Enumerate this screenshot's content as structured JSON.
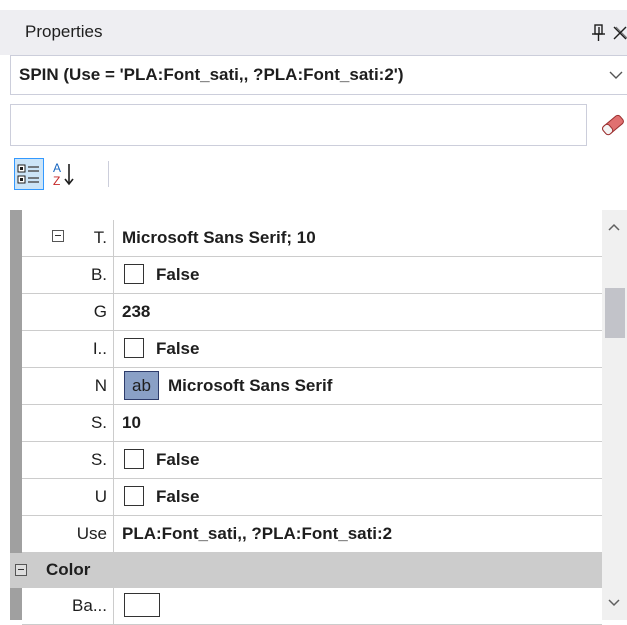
{
  "panel": {
    "title": "Properties",
    "pin_icon": "pin-icon",
    "close_icon": "close-icon"
  },
  "object_selector": {
    "value": "SPIN (Use = 'PLA:Font_sati,, ?PLA:Font_sati:2')"
  },
  "search": {
    "value": "",
    "eraser_icon": "eraser-icon"
  },
  "toolbar": {
    "categorized_icon": "categorized-view-icon",
    "alphabetical_icon": "alphabetical-sort-icon"
  },
  "grid": {
    "rows": [
      {
        "name": "T.",
        "value": "Microsoft Sans Serif; 10",
        "expanded": true
      },
      {
        "name": "B.",
        "value": "False",
        "checkbox": true
      },
      {
        "name": "G",
        "value": "238"
      },
      {
        "name": "I..",
        "value": "False",
        "checkbox": true
      },
      {
        "name": "N",
        "value": "Microsoft Sans Serif",
        "ab_prefix": "ab"
      },
      {
        "name": "S.",
        "value": "10"
      },
      {
        "name": "S.",
        "value": "False",
        "checkbox": true
      },
      {
        "name": "U",
        "value": "False",
        "checkbox": true
      },
      {
        "name": "Use",
        "value": "PLA:Font_sati,, ?PLA:Font_sati:2"
      }
    ],
    "category": {
      "label": "Color"
    },
    "color_row": {
      "name": "Ba...",
      "swatch_color": "#ffffff"
    }
  },
  "colors": {
    "title_bg": "#eeeef2",
    "gutter": "#a0a0a0",
    "category_bg": "#cccccc",
    "selected_ab": "#8aa0c6",
    "toolbar_active": "#cce4f7"
  }
}
